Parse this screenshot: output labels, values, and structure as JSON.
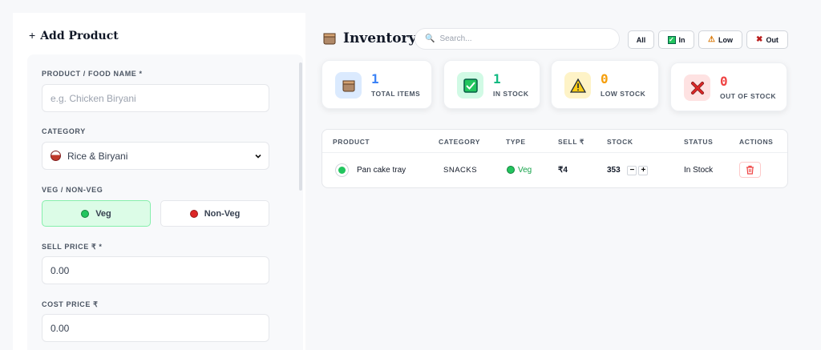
{
  "form": {
    "title": "Add Product",
    "plus": "+",
    "name_label": "PRODUCT / FOOD NAME *",
    "name_placeholder": "e.g. Chicken Biryani",
    "category_label": "CATEGORY",
    "category_value": "Rice & Biryani",
    "veg_label": "VEG / NON-VEG",
    "veg_option": "Veg",
    "nonveg_option": "Non-Veg",
    "sell_label": "SELL PRICE ₹ *",
    "sell_value": "0.00",
    "cost_label": "COST PRICE ₹",
    "cost_value": "0.00"
  },
  "inventory": {
    "title": "Inventory",
    "search_placeholder": "Search...",
    "filters": [
      "All",
      "In",
      "Low",
      "Out"
    ],
    "stats": [
      {
        "value": "1",
        "label": "TOTAL ITEMS",
        "color": "#3b82f6"
      },
      {
        "value": "1",
        "label": "IN STOCK",
        "color": "#10b981"
      },
      {
        "value": "0",
        "label": "LOW STOCK",
        "color": "#f59e0b"
      },
      {
        "value": "0",
        "label": "OUT OF STOCK",
        "color": "#ef4444"
      }
    ],
    "columns": [
      "PRODUCT",
      "CATEGORY",
      "TYPE",
      "SELL ₹",
      "STOCK",
      "STATUS",
      "ACTIONS"
    ],
    "rows": [
      {
        "product": "Pan cake tray",
        "category": "SNACKS",
        "type": "Veg",
        "sell": "₹4",
        "stock": "353",
        "status": "In Stock"
      }
    ]
  }
}
